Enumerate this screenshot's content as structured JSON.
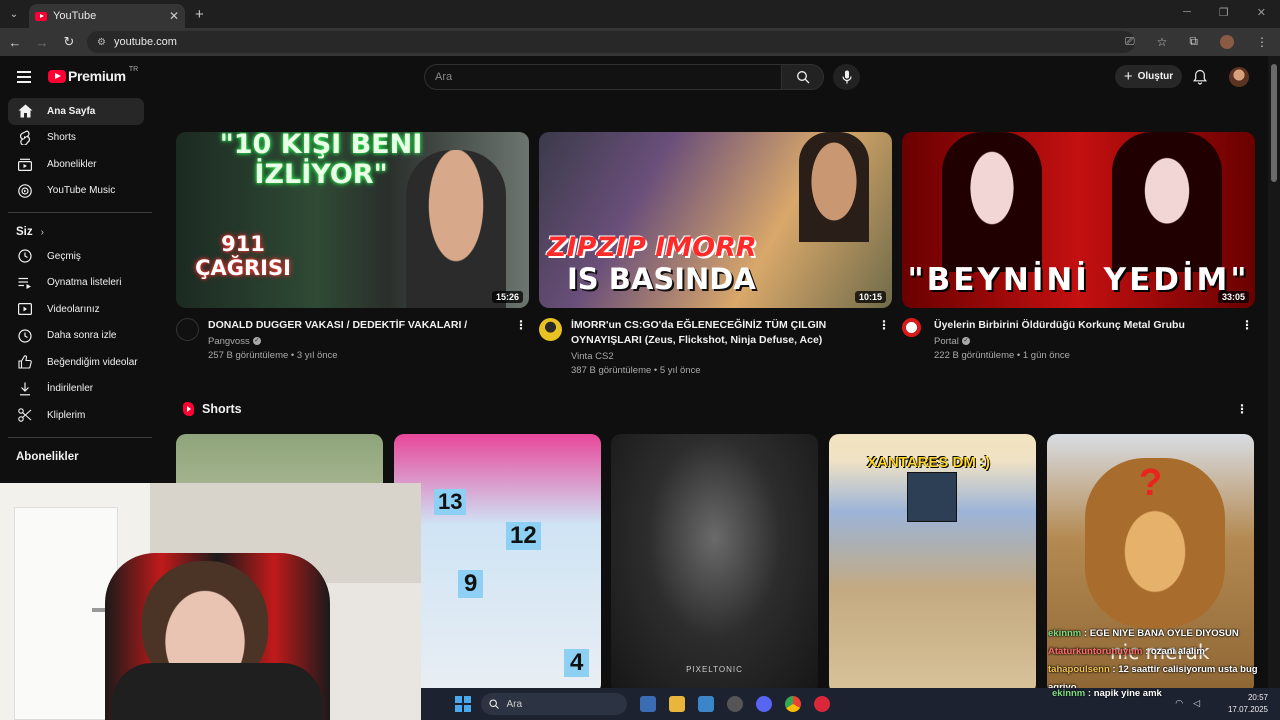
{
  "browser": {
    "tab_title": "YouTube",
    "url": "youtube.com"
  },
  "header": {
    "brand": "Premium",
    "region": "TR",
    "search_placeholder": "Ara",
    "create_label": "Oluştur"
  },
  "sidebar": {
    "main": [
      {
        "label": "Ana Sayfa",
        "icon": "home-icon"
      },
      {
        "label": "Shorts",
        "icon": "shorts-icon"
      },
      {
        "label": "Abonelikler",
        "icon": "subscriptions-icon"
      },
      {
        "label": "YouTube Music",
        "icon": "music-icon"
      }
    ],
    "you_heading": "Siz",
    "you_items": [
      {
        "label": "Geçmiş",
        "icon": "history-icon"
      },
      {
        "label": "Oynatma listeleri",
        "icon": "playlist-icon"
      },
      {
        "label": "Videolarınız",
        "icon": "your-videos-icon"
      },
      {
        "label": "Daha sonra izle",
        "icon": "watch-later-icon"
      },
      {
        "label": "Beğendiğim videolar",
        "icon": "like-icon"
      },
      {
        "label": "İndirilenler",
        "icon": "download-icon"
      },
      {
        "label": "Kliplerim",
        "icon": "clips-icon"
      }
    ],
    "subs_heading": "Abonelikler"
  },
  "videos": [
    {
      "title": "DONALD DUGGER VAKASI / DEDEKTİF VAKALARI /",
      "channel": "Pangvoss",
      "stats": "257 B görüntüleme • 3 yıl önce",
      "duration": "15:26",
      "thumb_text_top": "\"10 KİŞİ BENİ İZLİYOR\"",
      "thumb_text_side": "911 ÇAĞRISI"
    },
    {
      "title": "İMORR'un CS:GO'da EĞLENECEĞİNİZ TÜM ÇILGIN OYNAYIŞLARI (Zeus, Flickshot, Ninja Defuse, Ace)",
      "channel": "Vinta CS2",
      "stats": "387 B görüntüleme • 5 yıl önce",
      "duration": "10:15",
      "thumb_text_top": "ZIPZIP IMORR",
      "thumb_text_side": "IS BASINDA"
    },
    {
      "title": "Üyelerin Birbirini Öldürdüğü Korkunç Metal Grubu",
      "channel": "Portal",
      "stats": "222 B görüntüleme • 1 gün önce",
      "duration": "33:05",
      "thumb_text_top": "\"BEYNİNİ YEDİM\""
    }
  ],
  "shorts": {
    "heading": "Shorts",
    "items": [
      {
        "overlay": ""
      },
      {
        "overlay": ""
      },
      {
        "overlay": "PIXELTONIC"
      },
      {
        "overlay": "XANTARES DM :)"
      },
      {
        "overlay": "?"
      }
    ]
  },
  "chat": [
    {
      "user": "ekinnm",
      "text": ": EGE NIYE BANA OYLE DIYOSUN"
    },
    {
      "user": "Ataturkuntorunuyum",
      "text": ": ozani alalim"
    },
    {
      "user": "tahapoulsenn",
      "text": ": 12 saattir calisiyorum usta bug"
    },
    {
      "user": "",
      "text": "agriyo"
    },
    {
      "user": "ekinnm",
      "text": ": napik yine amk"
    }
  ],
  "chat_overlay_big": "nic merak",
  "taskbar": {
    "search_placeholder": "Ara",
    "time": "20:57",
    "date": "17.07.2025"
  }
}
